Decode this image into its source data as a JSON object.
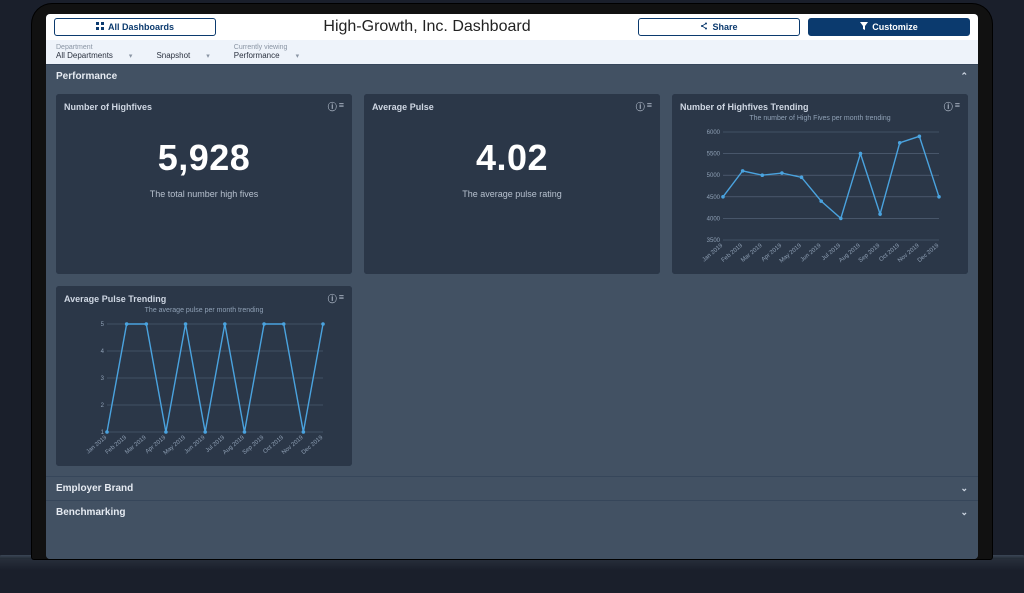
{
  "header": {
    "all_dashboards_label": "All Dashboards",
    "title": "High-Growth, Inc. Dashboard",
    "share_label": "Share",
    "customize_label": "Customize"
  },
  "filters": {
    "department_label": "Department",
    "department_value": "All Departments",
    "snapshot_label": "Snapshot",
    "viewing_label": "Currently viewing",
    "viewing_value": "Performance"
  },
  "sections": {
    "performance_title": "Performance",
    "employer_brand_title": "Employer Brand",
    "benchmarking_title": "Benchmarking"
  },
  "cards": {
    "highfives": {
      "title": "Number of Highfives",
      "value": "5,928",
      "desc": "The total number high fives"
    },
    "avg_pulse": {
      "title": "Average Pulse",
      "value": "4.02",
      "desc": "The average pulse rating"
    },
    "highfives_trend": {
      "title": "Number of Highfives Trending",
      "subtitle": "The number of High Fives per month trending"
    },
    "avg_pulse_trend": {
      "title": "Average Pulse Trending",
      "subtitle": "The average pulse per month trending"
    }
  },
  "chart_data": [
    {
      "id": "highfives_trend",
      "type": "line",
      "categories": [
        "Jan 2019",
        "Feb 2019",
        "Mar 2019",
        "Apr 2019",
        "May 2019",
        "Jun 2019",
        "Jul 2019",
        "Aug 2019",
        "Sep 2019",
        "Oct 2019",
        "Nov 2019",
        "Dec 2019"
      ],
      "values": [
        4500,
        5100,
        5000,
        5050,
        4950,
        4400,
        4000,
        5500,
        4100,
        5750,
        5900,
        4500
      ],
      "title": "The number of High Fives per month trending",
      "xlabel": "",
      "ylabel": "",
      "ylim": [
        3500,
        6000
      ],
      "yticks": [
        3500,
        4000,
        4500,
        5000,
        5500,
        6000
      ]
    },
    {
      "id": "avg_pulse_trend",
      "type": "line",
      "categories": [
        "Jan 2019",
        "Feb 2019",
        "Mar 2019",
        "Apr 2019",
        "May 2019",
        "Jun 2019",
        "Jul 2019",
        "Aug 2019",
        "Sep 2019",
        "Oct 2019",
        "Nov 2019",
        "Dec 2019"
      ],
      "values": [
        1,
        5,
        5,
        1,
        5,
        1,
        5,
        1,
        5,
        5,
        1,
        5
      ],
      "title": "The average pulse per month trending",
      "xlabel": "",
      "ylabel": "",
      "ylim": [
        1,
        5
      ],
      "yticks": [
        1,
        2,
        3,
        4,
        5
      ]
    }
  ],
  "colors": {
    "accent": "#0b3a6e",
    "chart_line": "#4aa3df",
    "panel": "#2b3748"
  }
}
